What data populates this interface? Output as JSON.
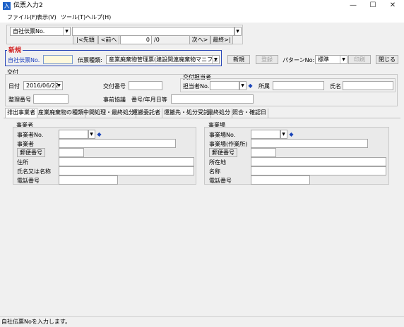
{
  "window": {
    "title": "伝票入力2",
    "minimize": "—",
    "maximize": "☐",
    "close": "✕"
  },
  "menu": [
    "ファイル(F)",
    "表示(V)",
    "ツール(T)",
    "ヘルプ(H)"
  ],
  "nav": {
    "field_select": "自社伝票No.",
    "first": "|<先頭",
    "prev": "<前へ",
    "position": "0",
    "total": "/0",
    "next": "次へ>",
    "last": "最終>|"
  },
  "header": {
    "new_badge": "新規",
    "denpyo_no_label": "自社伝票No.",
    "denpyo_type_label": "伝票種類:",
    "denpyo_type_value": "産業廃棄物管理票(建設関連廃棄物マニフェスト)",
    "new_button": "新規",
    "register_button": "登録",
    "pattern_label": "パターンNo:",
    "pattern_value": "標準",
    "print_button": "印刷",
    "close_button": "閉じる"
  },
  "issue": {
    "section": "交付",
    "date_label": "日付",
    "date_value": "2016/06/22",
    "doc_no_label": "交付番号",
    "person_section": "交付担当者",
    "person_no_label": "担当者No.",
    "dept_label": "所属",
    "name_label": "氏名",
    "seiri_label": "整理番号",
    "prior_label": "事前協議　番号/年月日等"
  },
  "tabs": [
    "排出事業者",
    "産業廃棄物の種類",
    "中間処理・最終処分",
    "運搬委託者",
    "運搬先・処分受託",
    "最終処分",
    "照合・確認日"
  ],
  "company": {
    "section": "事業者",
    "no_label": "事業者No.",
    "name_label": "事業者",
    "zip_button": "郵便番号",
    "address_label": "住所",
    "person_label": "氏名又は名称",
    "phone_label": "電話番号"
  },
  "site": {
    "section": "事業場",
    "no_label": "事業場No.",
    "name_label": "事業場(作業所)",
    "zip_button": "郵便番号",
    "address_label": "所在地",
    "person_label": "名称",
    "phone_label": "電話番号"
  },
  "status": "自社伝票Noを入力します。"
}
